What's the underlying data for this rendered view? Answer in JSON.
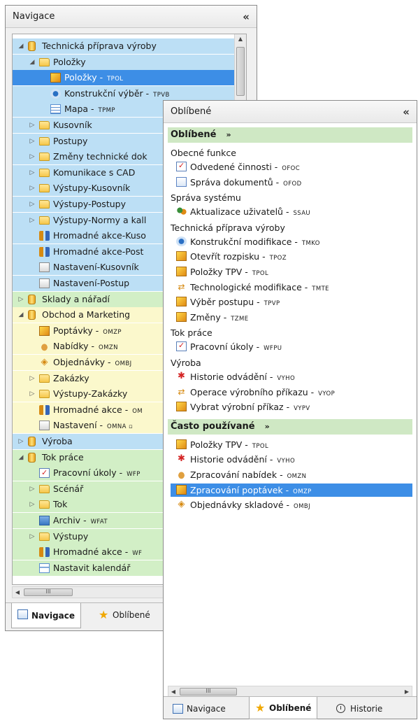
{
  "nav_panel": {
    "title": "Navigace",
    "collapse": "«",
    "tree": [
      {
        "label": "Technická příprava výroby",
        "code": "",
        "arrow": "◢",
        "icon": "cylinder-icon",
        "level": 0,
        "bg": "blue"
      },
      {
        "label": "Položky",
        "code": "",
        "arrow": "◢",
        "icon": "folder-icon",
        "level": 1,
        "bg": "blue"
      },
      {
        "label": "Položky",
        "code": "TPOL",
        "arrow": "",
        "icon": "cube-icon",
        "level": 2,
        "bg": "sel"
      },
      {
        "label": "Konstrukční výběr",
        "code": "TPVB",
        "arrow": "",
        "icon": "gears-icon",
        "level": 2,
        "bg": "blue"
      },
      {
        "label": "Mapa",
        "code": "TPMP",
        "arrow": "",
        "icon": "grid-icon",
        "level": 2,
        "bg": "blue"
      },
      {
        "label": "Kusovník",
        "code": "",
        "arrow": "▷",
        "icon": "folder-icon",
        "level": 1,
        "bg": "blue"
      },
      {
        "label": "Postupy",
        "code": "",
        "arrow": "▷",
        "icon": "folder-icon",
        "level": 1,
        "bg": "blue"
      },
      {
        "label": "Změny technické dok",
        "code": "",
        "arrow": "▷",
        "icon": "folder-icon",
        "level": 1,
        "bg": "blue"
      },
      {
        "label": "Komunikace s CAD",
        "code": "",
        "arrow": "▷",
        "icon": "folder-icon",
        "level": 1,
        "bg": "blue"
      },
      {
        "label": "Výstupy-Kusovník",
        "code": "",
        "arrow": "▷",
        "icon": "folder-icon",
        "level": 1,
        "bg": "blue"
      },
      {
        "label": "Výstupy-Postupy",
        "code": "",
        "arrow": "▷",
        "icon": "folder-icon",
        "level": 1,
        "bg": "blue"
      },
      {
        "label": "Výstupy-Normy a kall",
        "code": "",
        "arrow": "▷",
        "icon": "folder-icon",
        "level": 1,
        "bg": "blue"
      },
      {
        "label": "Hromadné akce-Kuso",
        "code": "",
        "arrow": "",
        "icon": "action-icon",
        "level": 1,
        "bg": "blue"
      },
      {
        "label": "Hromadné akce-Post",
        "code": "",
        "arrow": "",
        "icon": "action-icon",
        "level": 1,
        "bg": "blue"
      },
      {
        "label": "Nastavení-Kusovník",
        "code": "",
        "arrow": "",
        "icon": "settings-icon",
        "level": 1,
        "bg": "blue"
      },
      {
        "label": "Nastavení-Postup",
        "code": "",
        "arrow": "",
        "icon": "settings-icon",
        "level": 1,
        "bg": "blue"
      },
      {
        "label": "Sklady a nářadí",
        "code": "",
        "arrow": "▷",
        "icon": "cylinder-icon",
        "level": 0,
        "bg": "green"
      },
      {
        "label": "Obchod a Marketing",
        "code": "",
        "arrow": "◢",
        "icon": "cylinder-icon",
        "level": 0,
        "bg": "yellow"
      },
      {
        "label": "Poptávky",
        "code": "OMZP",
        "arrow": "",
        "icon": "cube-icon",
        "level": 1,
        "bg": "yellow"
      },
      {
        "label": "Nabídky",
        "code": "OMZN",
        "arrow": "",
        "icon": "handshake-icon",
        "level": 1,
        "bg": "yellow"
      },
      {
        "label": "Objednávky",
        "code": "OMBJ",
        "arrow": "",
        "icon": "diamond-icon",
        "level": 1,
        "bg": "yellow"
      },
      {
        "label": "Zakázky",
        "code": "",
        "arrow": "▷",
        "icon": "folder-icon",
        "level": 1,
        "bg": "yellow"
      },
      {
        "label": "Výstupy-Zakázky",
        "code": "",
        "arrow": "▷",
        "icon": "folder-icon",
        "level": 1,
        "bg": "yellow"
      },
      {
        "label": "Hromadné akce",
        "code": "OM",
        "arrow": "",
        "icon": "action-icon",
        "level": 1,
        "bg": "yellow"
      },
      {
        "label": "Nastavení",
        "code": "OMNA ▫",
        "arrow": "",
        "icon": "settings-icon",
        "level": 1,
        "bg": "yellow"
      },
      {
        "label": "Výroba",
        "code": "",
        "arrow": "▷",
        "icon": "cylinder-icon",
        "level": 0,
        "bg": "blue"
      },
      {
        "label": "Tok práce",
        "code": "",
        "arrow": "◢",
        "icon": "cylinder-icon",
        "level": 0,
        "bg": "green"
      },
      {
        "label": "Pracovní úkoly",
        "code": "WFP",
        "arrow": "",
        "icon": "check-icon",
        "level": 1,
        "bg": "green"
      },
      {
        "label": "Scénář",
        "code": "",
        "arrow": "▷",
        "icon": "folder-icon",
        "level": 1,
        "bg": "green"
      },
      {
        "label": "Tok",
        "code": "",
        "arrow": "▷",
        "icon": "folder-icon",
        "level": 1,
        "bg": "green"
      },
      {
        "label": "Archiv",
        "code": "WFAT",
        "arrow": "",
        "icon": "archive-icon",
        "level": 1,
        "bg": "green"
      },
      {
        "label": "Výstupy",
        "code": "",
        "arrow": "▷",
        "icon": "folder-icon",
        "level": 1,
        "bg": "green"
      },
      {
        "label": "Hromadné akce",
        "code": "WF",
        "arrow": "",
        "icon": "action-icon",
        "level": 1,
        "bg": "green"
      },
      {
        "label": "Nastavit kalendář",
        "code": "",
        "arrow": "",
        "icon": "calendar-icon",
        "level": 1,
        "bg": "green"
      }
    ],
    "hscroll_thumb": "III",
    "tabs": [
      {
        "label": "Navigace",
        "icon": "navigation-icon",
        "active": true
      },
      {
        "label": "Oblíbené",
        "icon": "star-icon",
        "active": false
      }
    ]
  },
  "fav_panel": {
    "title": "Oblíbené",
    "collapse": "«",
    "sections": [
      {
        "title": "Oblíbené",
        "chev": "»",
        "groups": [
          {
            "title": "Obecné funkce",
            "items": [
              {
                "label": "Odvedené činnosti",
                "code": "OFOC",
                "icon": "check-icon"
              },
              {
                "label": "Správa dokumentů",
                "code": "OFOD",
                "icon": "doc-icon"
              }
            ]
          },
          {
            "title": "Správa systému",
            "items": [
              {
                "label": "Aktualizace uživatelů",
                "code": "SSAU",
                "icon": "people-icon"
              }
            ]
          },
          {
            "title": "Technická příprava výroby",
            "items": [
              {
                "label": "Konstrukční modifikace",
                "code": "TMKO",
                "icon": "gears-icon"
              },
              {
                "label": "Otevřít rozpisku",
                "code": "TPOZ",
                "icon": "cube-icon"
              },
              {
                "label": "Položky TPV",
                "code": "TPOL",
                "icon": "cube-icon"
              },
              {
                "label": "Technologické modifikace",
                "code": "TMTE",
                "icon": "swap-icon"
              },
              {
                "label": "Výběr postupu",
                "code": "TPVP",
                "icon": "cube-icon"
              },
              {
                "label": "Změny",
                "code": "TZME",
                "icon": "cube-icon"
              }
            ]
          },
          {
            "title": "Tok práce",
            "items": [
              {
                "label": "Pracovní úkoly",
                "code": "WFPU",
                "icon": "check-icon"
              }
            ]
          },
          {
            "title": "Výroba",
            "items": [
              {
                "label": "Historie odvádění",
                "code": "VYHO",
                "icon": "star-red-icon"
              },
              {
                "label": "Operace výrobního příkazu",
                "code": "VYOP",
                "icon": "swap-icon"
              },
              {
                "label": "Vybrat výrobní příkaz",
                "code": "VYPV",
                "icon": "cube-icon"
              }
            ]
          }
        ]
      },
      {
        "title": "Často používané",
        "chev": "»",
        "items": [
          {
            "label": "Položky TPV",
            "code": "TPOL",
            "icon": "cube-icon",
            "selected": false
          },
          {
            "label": "Historie odvádění",
            "code": "VYHO",
            "icon": "star-red-icon",
            "selected": false
          },
          {
            "label": "Zpracování nabídek",
            "code": "OMZN",
            "icon": "handshake-icon",
            "selected": false
          },
          {
            "label": "Zpracování poptávek",
            "code": "OMZP",
            "icon": "cube-icon",
            "selected": true
          },
          {
            "label": "Objednávky skladové",
            "code": "OMBJ",
            "icon": "diamond-icon",
            "selected": false
          }
        ]
      }
    ],
    "hscroll_thumb": "III",
    "tabs": [
      {
        "label": "Navigace",
        "icon": "navigation-icon",
        "active": false
      },
      {
        "label": "Oblíbené",
        "icon": "star-icon",
        "active": true
      },
      {
        "label": "Historie",
        "icon": "clock-icon",
        "active": false
      }
    ]
  }
}
